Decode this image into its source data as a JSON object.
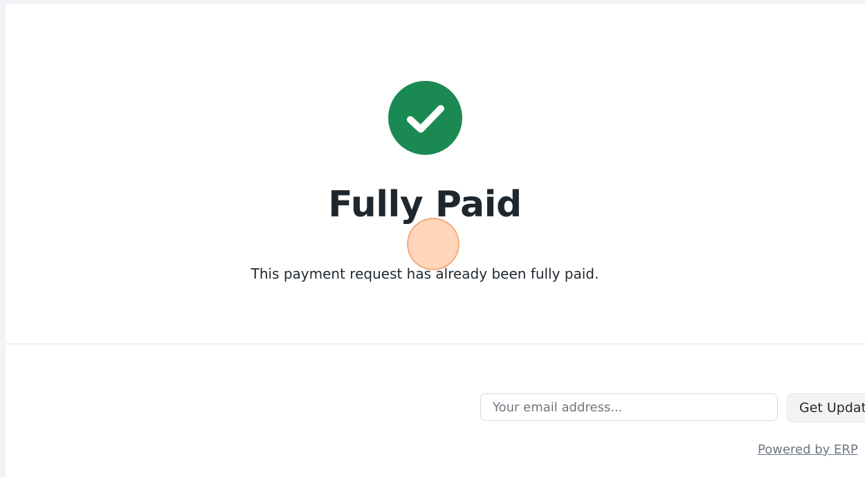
{
  "status": {
    "icon": "check-circle-icon",
    "color": "#1b8a52",
    "title": "Fully Paid",
    "message": "This payment request has already been fully paid."
  },
  "footer": {
    "email_placeholder": "Your email address...",
    "subscribe_label": "Get Updates",
    "powered_by": "Powered by ERP"
  }
}
